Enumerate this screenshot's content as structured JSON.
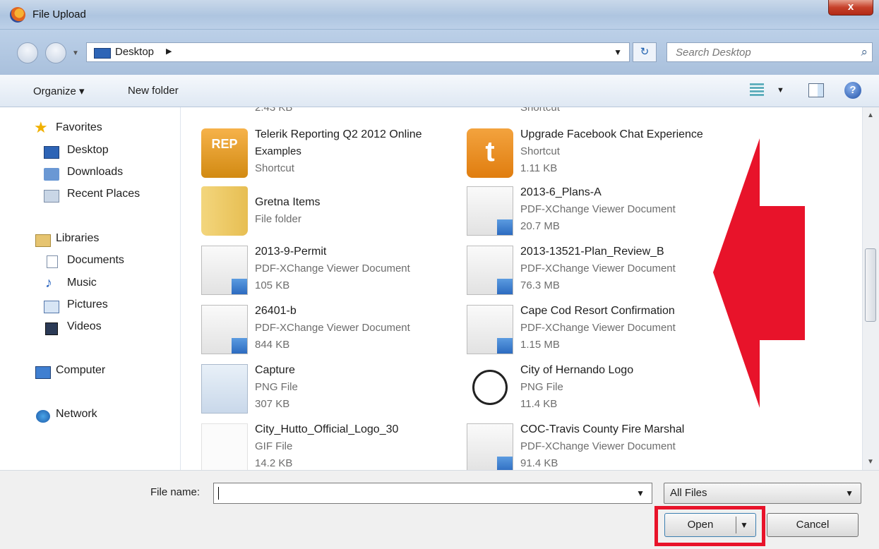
{
  "window": {
    "title": "File Upload",
    "close_label": "x"
  },
  "address_bar": {
    "location": "Desktop",
    "search_placeholder": "Search Desktop"
  },
  "toolbar": {
    "organize": "Organize ▾",
    "new_folder": "New folder"
  },
  "sidebar": {
    "favorites": "Favorites",
    "desktop": "Desktop",
    "downloads": "Downloads",
    "recent_places": "Recent Places",
    "libraries": "Libraries",
    "documents": "Documents",
    "music": "Music",
    "pictures": "Pictures",
    "videos": "Videos",
    "computer": "Computer",
    "network": "Network"
  },
  "files": [
    {
      "name": "",
      "line1": "2.43 KB",
      "line2": "",
      "icon": "shortcut-icon"
    },
    {
      "name": "",
      "line1": "Shortcut",
      "line2": "",
      "icon": "shortcut-icon"
    },
    {
      "name": "Telerik Reporting Q2 2012 Online",
      "line1": "Examples",
      "line2": "Shortcut",
      "icon": "telerik-rep-icon"
    },
    {
      "name": "Upgrade Facebook Chat Experience",
      "line1": "Shortcut",
      "line2": "1.11 KB",
      "icon": "tumblr-t-icon"
    },
    {
      "name": "Gretna Items",
      "line1": "File folder",
      "line2": "",
      "icon": "folder-icon"
    },
    {
      "name": "2013-6_Plans-A",
      "line1": "PDF-XChange Viewer Document",
      "line2": "20.7 MB",
      "icon": "pdf-doc-icon"
    },
    {
      "name": "2013-9-Permit",
      "line1": "PDF-XChange Viewer Document",
      "line2": "105 KB",
      "icon": "pdf-doc-icon"
    },
    {
      "name": "2013-13521-Plan_Review_B",
      "line1": "PDF-XChange Viewer Document",
      "line2": "76.3 MB",
      "icon": "pdf-doc-icon"
    },
    {
      "name": "26401-b",
      "line1": "PDF-XChange Viewer Document",
      "line2": "844 KB",
      "icon": "pdf-doc-icon"
    },
    {
      "name": "Cape Cod Resort Confirmation",
      "line1": "PDF-XChange Viewer Document",
      "line2": "1.15 MB",
      "icon": "pdf-doc-icon"
    },
    {
      "name": "Capture",
      "line1": "PNG File",
      "line2": "307 KB",
      "icon": "png-image-icon"
    },
    {
      "name": "City of Hernando Logo",
      "line1": "PNG File",
      "line2": "11.4 KB",
      "icon": "seal-logo-icon"
    },
    {
      "name": "City_Hutto_Official_Logo_30",
      "line1": "GIF File",
      "line2": "14.2 KB",
      "icon": "gif-image-icon"
    },
    {
      "name": "COC-Travis County Fire Marshal",
      "line1": "PDF-XChange Viewer Document",
      "line2": "91.4 KB",
      "icon": "pdf-doc-icon"
    }
  ],
  "footer": {
    "file_name_label": "File name:",
    "file_name_value": "",
    "filter_value": "All Files",
    "open_label": "Open",
    "cancel_label": "Cancel"
  },
  "colors": {
    "annotation_red": "#e8132a",
    "title_bar": "#aec5e0"
  }
}
